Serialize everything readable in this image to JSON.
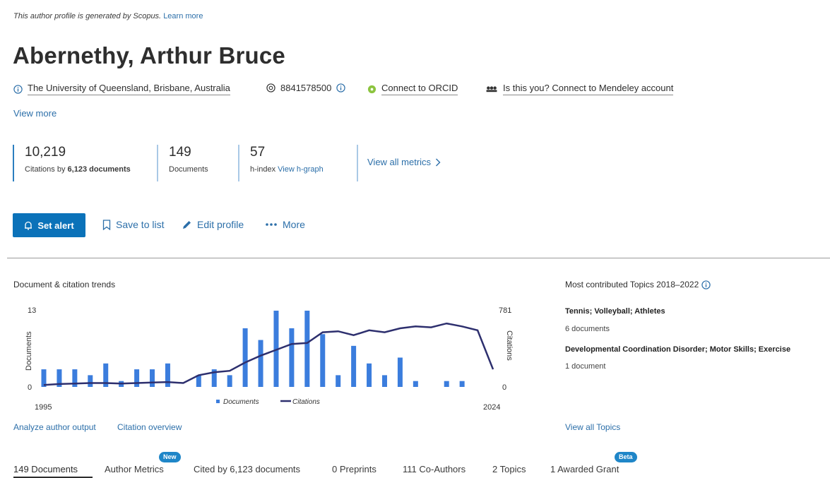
{
  "notice": {
    "text": "This author profile is generated by Scopus.",
    "link": "Learn more"
  },
  "author": {
    "name": "Abernethy, Arthur Bruce"
  },
  "meta": {
    "affiliation": "The University of Queensland, Brisbane, Australia",
    "author_id": "8841578500",
    "orcid": "Connect to ORCID",
    "mendeley": "Is this you? Connect to Mendeley account",
    "view_more": "View more"
  },
  "metrics": {
    "citations": {
      "value": "10,219",
      "label_prefix": "Citations by ",
      "label_bold": "6,123 documents"
    },
    "documents": {
      "value": "149",
      "label": "Documents"
    },
    "hindex": {
      "value": "57",
      "label": "h-index",
      "link": "View h-graph"
    },
    "view_all": "View all metrics"
  },
  "actions": {
    "set_alert": "Set alert",
    "save_to_list": "Save to list",
    "edit_profile": "Edit profile",
    "more": "More"
  },
  "trends": {
    "title": "Document & citation trends",
    "link_analyze": "Analyze author output",
    "link_overview": "Citation overview"
  },
  "topics": {
    "title": "Most contributed Topics 2018–2022",
    "items": [
      {
        "name": "Tennis; Volleyball; Athletes",
        "count": "6 documents"
      },
      {
        "name": "Developmental Coordination Disorder; Motor Skills; Exercise",
        "count": "1 document"
      }
    ],
    "view_all": "View all Topics"
  },
  "tabs": [
    {
      "label": "149 Documents"
    },
    {
      "label": "Author Metrics",
      "badge": "New"
    },
    {
      "label": "Cited by 6,123 documents"
    },
    {
      "label": "0 Preprints"
    },
    {
      "label": "111 Co-Authors"
    },
    {
      "label": "2 Topics"
    },
    {
      "label": "1 Awarded Grant",
      "badge": "Beta"
    }
  ],
  "chart_data": {
    "type": "bar",
    "x_start_label": "1995",
    "x_end_label": "2024",
    "ylabel": "Documents",
    "y2label": "Citations",
    "ylim": [
      0,
      13
    ],
    "y2lim": [
      0,
      781
    ],
    "y_ticks": [
      "13",
      "0"
    ],
    "y2_ticks": [
      "781",
      "0"
    ],
    "legend": [
      "Documents",
      "Citations"
    ],
    "legend_position": "bottom-center",
    "colors": {
      "documents": "#3b7ddd",
      "citations": "#2d2f6e"
    },
    "series": [
      {
        "name": "Documents",
        "values": [
          3,
          3,
          3,
          2,
          4,
          1,
          3,
          3,
          4,
          0,
          2,
          3,
          2,
          10,
          8,
          13,
          10,
          13,
          9,
          2,
          7,
          4,
          2,
          5,
          1,
          0,
          1,
          1,
          0,
          0
        ]
      },
      {
        "name": "Citations",
        "values": [
          20,
          30,
          35,
          40,
          40,
          35,
          40,
          45,
          50,
          40,
          120,
          150,
          165,
          250,
          320,
          380,
          440,
          450,
          560,
          570,
          530,
          580,
          560,
          600,
          620,
          610,
          650,
          620,
          580,
          180
        ]
      }
    ]
  }
}
